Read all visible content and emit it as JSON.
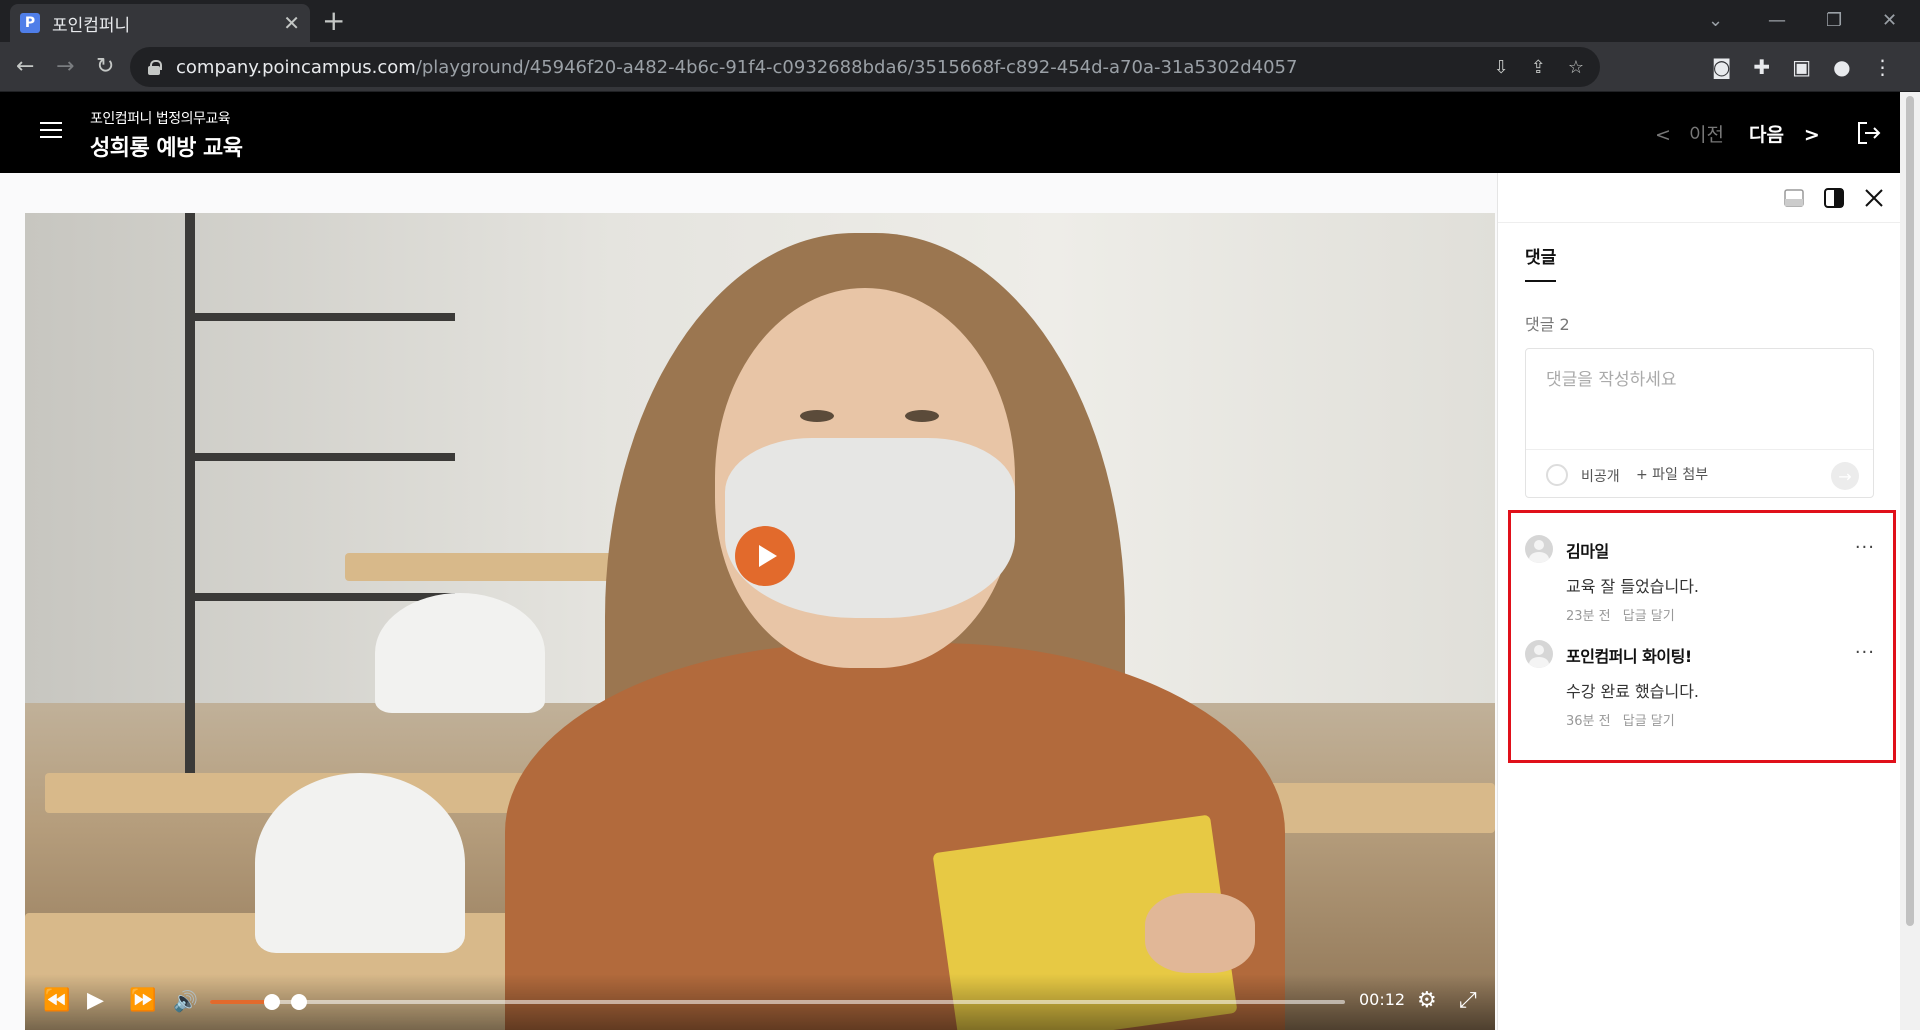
{
  "browser": {
    "tab_title": "포인컴퍼니",
    "favicon_letter": "P",
    "url_host": "company.poincampus.com",
    "url_path": "/playground/45946f20-a482-4b6c-91f4-c0932688bda6/3515668f-c892-454d-a70a-31a5302d4057",
    "icons": [
      "back-icon",
      "forward-icon",
      "reload-icon",
      "lock-icon",
      "install-icon",
      "share-icon",
      "star-icon",
      "camera-icon",
      "extensions-icon",
      "sidepanel-icon",
      "profile-icon",
      "menu-icon"
    ]
  },
  "header": {
    "org": "포인컴퍼니 법정의무교육",
    "title": "성희롱 예방 교육",
    "prev_label": "이전",
    "next_label": "다음"
  },
  "player": {
    "time": "00:12",
    "progress_fraction": 0.055,
    "buffered_fraction": 0.078
  },
  "comments_panel": {
    "tab_label": "댓글",
    "count_label": "댓글 2",
    "placeholder": "댓글을 작성하세요",
    "private_label": "비공개",
    "attach_label": "+ 파일 첨부",
    "items": [
      {
        "author": "김마일",
        "body": "교육 잘 들었습니다.",
        "time": "23분 전",
        "reply": "답글 달기",
        "more": "···"
      },
      {
        "author": "포인컴퍼니 화이팅!",
        "body": "수강 완료 했습니다.",
        "time": "36분 전",
        "reply": "답글 달기",
        "more": "···"
      }
    ],
    "highlight_color": "#e0101a"
  },
  "colors": {
    "accent": "#e26a2c",
    "header_bg": "#000000"
  }
}
